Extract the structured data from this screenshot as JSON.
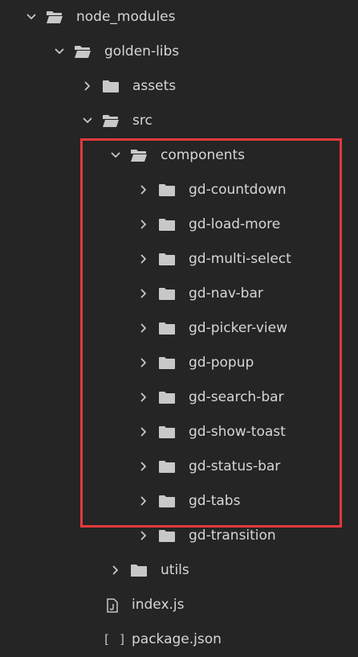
{
  "tree": [
    {
      "label": "node_modules",
      "type": "folder",
      "expanded": true,
      "depth": 0
    },
    {
      "label": "golden-libs",
      "type": "folder",
      "expanded": true,
      "depth": 1
    },
    {
      "label": "assets",
      "type": "folder",
      "expanded": false,
      "depth": 2
    },
    {
      "label": "src",
      "type": "folder",
      "expanded": true,
      "depth": 2
    },
    {
      "label": "components",
      "type": "folder",
      "expanded": true,
      "depth": 3
    },
    {
      "label": "gd-countdown",
      "type": "folder",
      "expanded": false,
      "depth": 4
    },
    {
      "label": "gd-load-more",
      "type": "folder",
      "expanded": false,
      "depth": 4
    },
    {
      "label": "gd-multi-select",
      "type": "folder",
      "expanded": false,
      "depth": 4
    },
    {
      "label": "gd-nav-bar",
      "type": "folder",
      "expanded": false,
      "depth": 4
    },
    {
      "label": "gd-picker-view",
      "type": "folder",
      "expanded": false,
      "depth": 4
    },
    {
      "label": "gd-popup",
      "type": "folder",
      "expanded": false,
      "depth": 4
    },
    {
      "label": "gd-search-bar",
      "type": "folder",
      "expanded": false,
      "depth": 4
    },
    {
      "label": "gd-show-toast",
      "type": "folder",
      "expanded": false,
      "depth": 4
    },
    {
      "label": "gd-status-bar",
      "type": "folder",
      "expanded": false,
      "depth": 4
    },
    {
      "label": "gd-tabs",
      "type": "folder",
      "expanded": false,
      "depth": 4
    },
    {
      "label": "gd-transition",
      "type": "folder",
      "expanded": false,
      "depth": 4
    },
    {
      "label": "utils",
      "type": "folder",
      "expanded": false,
      "depth": 3
    },
    {
      "label": "index.js",
      "type": "js-file",
      "depth": 3
    },
    {
      "label": "package.json",
      "type": "json-file",
      "depth": 3,
      "icon_text": "[ ]"
    }
  ],
  "colors": {
    "background": "#252526",
    "text": "#d6d6d6",
    "icon": "#c8c8c8",
    "highlight_border": "#e0393c"
  },
  "highlight": {
    "first_item": "components",
    "last_item": "gd-transition"
  }
}
